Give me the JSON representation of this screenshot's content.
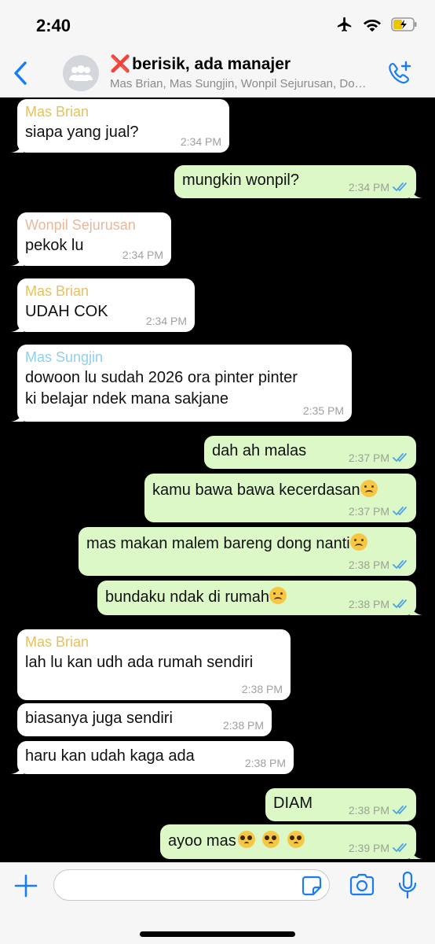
{
  "status_bar": {
    "time": "2:40"
  },
  "header": {
    "title_prefix": "❌",
    "title": "berisik, ada manajer",
    "subtitle": "Mas Brian, Mas Sungjin, Wonpil Sejurusan, Dowoon"
  },
  "colors": {
    "accent": "#1a7cf5",
    "mas_brian": "#e6c15f",
    "wonpil": "#e9b89b",
    "mas_sungjin": "#8fd0ea",
    "outgoing_bubble": "#dcf8c6",
    "read_tick": "#4fa3e0"
  },
  "messages": [
    {
      "dir": "in",
      "sender": "Mas Brian",
      "text": "siapa yang jual?",
      "time": "2:34 PM"
    },
    {
      "dir": "out",
      "text": "mungkin wonpil?",
      "time": "2:34 PM"
    },
    {
      "dir": "in",
      "sender": "Wonpil Sejurusan",
      "text": "pekok lu",
      "time": "2:34 PM"
    },
    {
      "dir": "in",
      "sender": "Mas Brian",
      "text": "UDAH COK",
      "time": "2:34 PM"
    },
    {
      "dir": "in",
      "sender": "Mas Sungjin",
      "line1": "dowoon lu sudah 2026 ora pinter pinter",
      "line2": "ki belajar ndek mana sakjane",
      "time": "2:35 PM"
    },
    {
      "dir": "out",
      "text": "dah ah malas",
      "time": "2:37 PM"
    },
    {
      "dir": "out",
      "text": "kamu bawa bawa kecerdasan",
      "emoji": "slightly-frowning-face",
      "time": "2:37 PM"
    },
    {
      "dir": "out",
      "text": "mas makan malem bareng dong nanti",
      "emoji": "frowning-face",
      "time": "2:38 PM"
    },
    {
      "dir": "out",
      "text": "bundaku ndak di rumah",
      "emoji": "frowning-face",
      "time": "2:38 PM"
    },
    {
      "dir": "in",
      "sender": "Mas Brian",
      "text": "lah lu kan udh ada rumah sendiri",
      "time": "2:38 PM"
    },
    {
      "dir": "in",
      "text": "biasanya juga sendiri",
      "time": "2:38 PM"
    },
    {
      "dir": "in",
      "text": "haru kan udah kaga ada",
      "time": "2:38 PM"
    },
    {
      "dir": "out",
      "text": "DIAM",
      "time": "2:38 PM"
    },
    {
      "dir": "out",
      "text": "ayoo mas",
      "emoji": "pleading-face",
      "time": "2:39 PM"
    }
  ],
  "input": {
    "placeholder": ""
  }
}
